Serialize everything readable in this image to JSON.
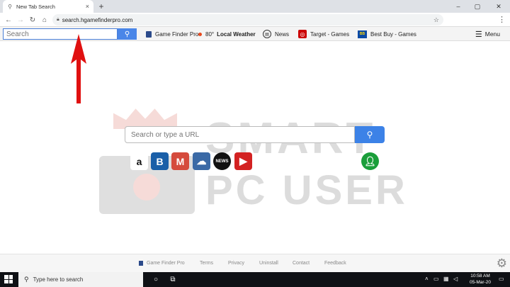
{
  "browser": {
    "tab_title": "New Tab Search",
    "tab_close": "×",
    "new_tab": "+",
    "window_controls": [
      "–",
      "▢",
      "✕"
    ],
    "url": "search.hgamefinderpro.com"
  },
  "extension_bar": {
    "search_placeholder": "Search",
    "links": [
      {
        "label": "Game Finder Pro",
        "icon": "game-finder-icon"
      },
      {
        "temp": "80°",
        "label": "Local Weather",
        "icon": "weather-dot-icon"
      },
      {
        "label": "News",
        "icon": "news-icon"
      },
      {
        "label": "Target - Games",
        "icon": "target-icon"
      },
      {
        "label": "Best Buy - Games",
        "icon": "bestbuy-icon"
      }
    ],
    "menu_label": "Menu"
  },
  "watermark": {
    "line1": "SMART",
    "line2": "PC USER"
  },
  "main": {
    "search_placeholder": "Search or type a URL",
    "quick_links": [
      {
        "icon": "amazon-icon",
        "glyph": "a",
        "bg": "#ffffff",
        "fg": "#111111"
      },
      {
        "icon": "booking-icon",
        "glyph": "B",
        "bg": "#1a5fa8",
        "fg": "#ffffff"
      },
      {
        "icon": "gmail-icon",
        "glyph": "M",
        "bg": "#d54b3d",
        "fg": "#ffffff"
      },
      {
        "icon": "weather-icon",
        "glyph": "☁",
        "bg": "#3b6aa6",
        "fg": "#ffffff"
      },
      {
        "icon": "news-icon",
        "glyph": "NEWS",
        "bg": "#111111",
        "fg": "#ffffff"
      },
      {
        "icon": "youtube-icon",
        "glyph": "▶",
        "bg": "#d32222",
        "fg": "#ffffff"
      }
    ],
    "user_icon": "user-icon"
  },
  "footer": {
    "links": [
      "Game Finder Pro",
      "Terms",
      "Privacy",
      "Uninstall",
      "Contact",
      "Feedback"
    ]
  },
  "taskbar": {
    "search_text": "Type here to search",
    "time": "10:58 AM",
    "date": "05-Mar-20"
  },
  "colors": {
    "accent": "#3c82e7",
    "arrow": "#e01010"
  }
}
